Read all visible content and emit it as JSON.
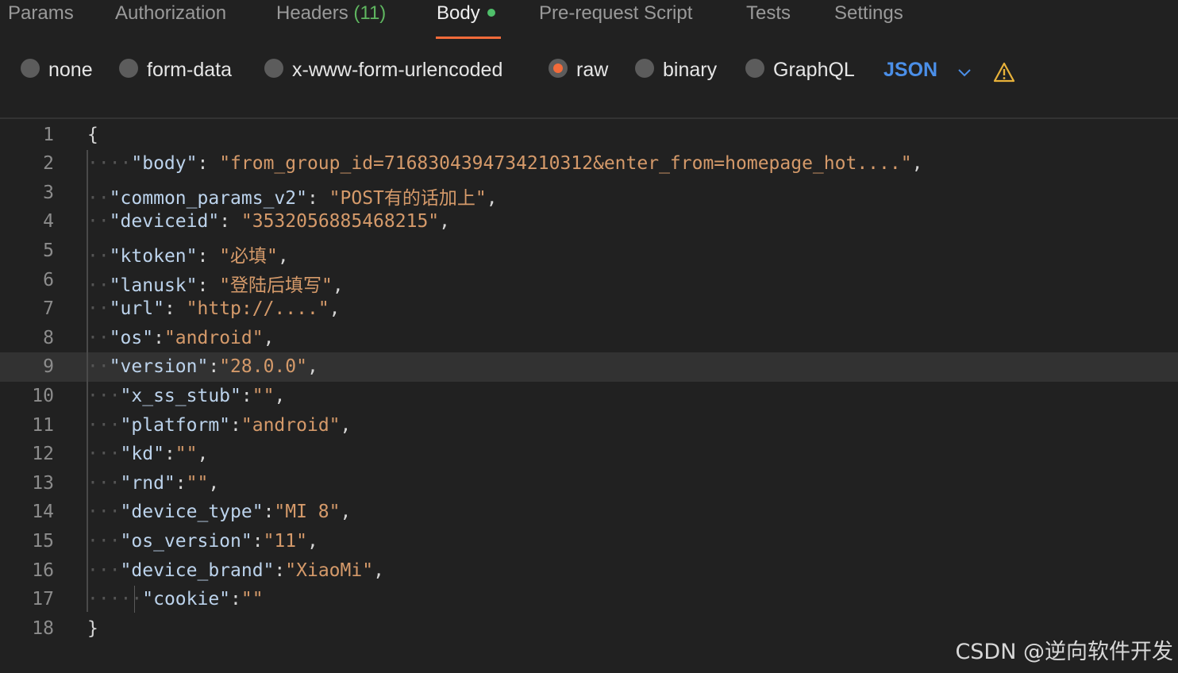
{
  "tabs": {
    "params": "Params",
    "authorization": "Authorization",
    "headers": "Headers",
    "headers_count": "(11)",
    "body": "Body",
    "prerequest": "Pre-request Script",
    "tests": "Tests",
    "settings": "Settings",
    "active": "Body"
  },
  "body_types": {
    "none": "none",
    "form_data": "form-data",
    "urlencoded": "x-www-form-urlencoded",
    "raw": "raw",
    "binary": "binary",
    "graphql": "GraphQL",
    "selected": "raw",
    "language": "JSON"
  },
  "colors": {
    "accent": "#f26b3a",
    "link_blue": "#4b8fe8",
    "status_green": "#4fbf6a",
    "warning": "#e8b23a"
  },
  "icons": {
    "chevron": "chevron-down-icon",
    "warning": "warning-triangle-icon"
  },
  "editor": {
    "highlighted_line": 9,
    "lines": [
      {
        "n": "1",
        "ws": "",
        "key": "",
        "sep": "",
        "val": "",
        "tail": "{"
      },
      {
        "n": "2",
        "ws": "····",
        "key": "\"body\"",
        "sep": ": ",
        "val": "\"from_group_id=7168304394734210312&enter_from=homepage_hot....\"",
        "tail": ","
      },
      {
        "n": "3",
        "ws": "··",
        "key": "\"common_params_v2\"",
        "sep": ": ",
        "val": "\"POST有的话加上\"",
        "tail": ","
      },
      {
        "n": "4",
        "ws": "··",
        "key": "\"deviceid\"",
        "sep": ": ",
        "val": "\"3532056885468215\"",
        "tail": ","
      },
      {
        "n": "5",
        "ws": "··",
        "key": "\"ktoken\"",
        "sep": ": ",
        "val": "\"必填\"",
        "tail": ","
      },
      {
        "n": "6",
        "ws": "··",
        "key": "\"lanusk\"",
        "sep": ": ",
        "val": "\"登陆后填写\"",
        "tail": ","
      },
      {
        "n": "7",
        "ws": "··",
        "key": "\"url\"",
        "sep": ": ",
        "val": "\"http://....\"",
        "tail": ","
      },
      {
        "n": "8",
        "ws": "··",
        "key": "\"os\"",
        "sep": ":",
        "val": "\"android\"",
        "tail": ","
      },
      {
        "n": "9",
        "ws": "··",
        "key": "\"version\"",
        "sep": ":",
        "val": "\"28.0.0\"",
        "tail": ","
      },
      {
        "n": "10",
        "ws": "···",
        "key": "\"x_ss_stub\"",
        "sep": ":",
        "val": "\"\"",
        "tail": ","
      },
      {
        "n": "11",
        "ws": "···",
        "key": "\"platform\"",
        "sep": ":",
        "val": "\"android\"",
        "tail": ","
      },
      {
        "n": "12",
        "ws": "···",
        "key": "\"kd\"",
        "sep": ":",
        "val": "\"\"",
        "tail": ","
      },
      {
        "n": "13",
        "ws": "···",
        "key": "\"rnd\"",
        "sep": ":",
        "val": "\"\"",
        "tail": ","
      },
      {
        "n": "14",
        "ws": "···",
        "key": "\"device_type\"",
        "sep": ":",
        "val": "\"MI 8\"",
        "tail": ","
      },
      {
        "n": "15",
        "ws": "···",
        "key": "\"os_version\"",
        "sep": ":",
        "val": "\"11\"",
        "tail": ","
      },
      {
        "n": "16",
        "ws": "···",
        "key": "\"device_brand\"",
        "sep": ":",
        "val": "\"XiaoMi\"",
        "tail": ","
      },
      {
        "n": "17",
        "ws": "·····",
        "key": "\"cookie\"",
        "sep": ":",
        "val": "\"\"",
        "tail": ""
      },
      {
        "n": "18",
        "ws": "",
        "key": "",
        "sep": "",
        "val": "",
        "tail": "}"
      }
    ]
  },
  "watermark": "CSDN @逆向软件开发"
}
